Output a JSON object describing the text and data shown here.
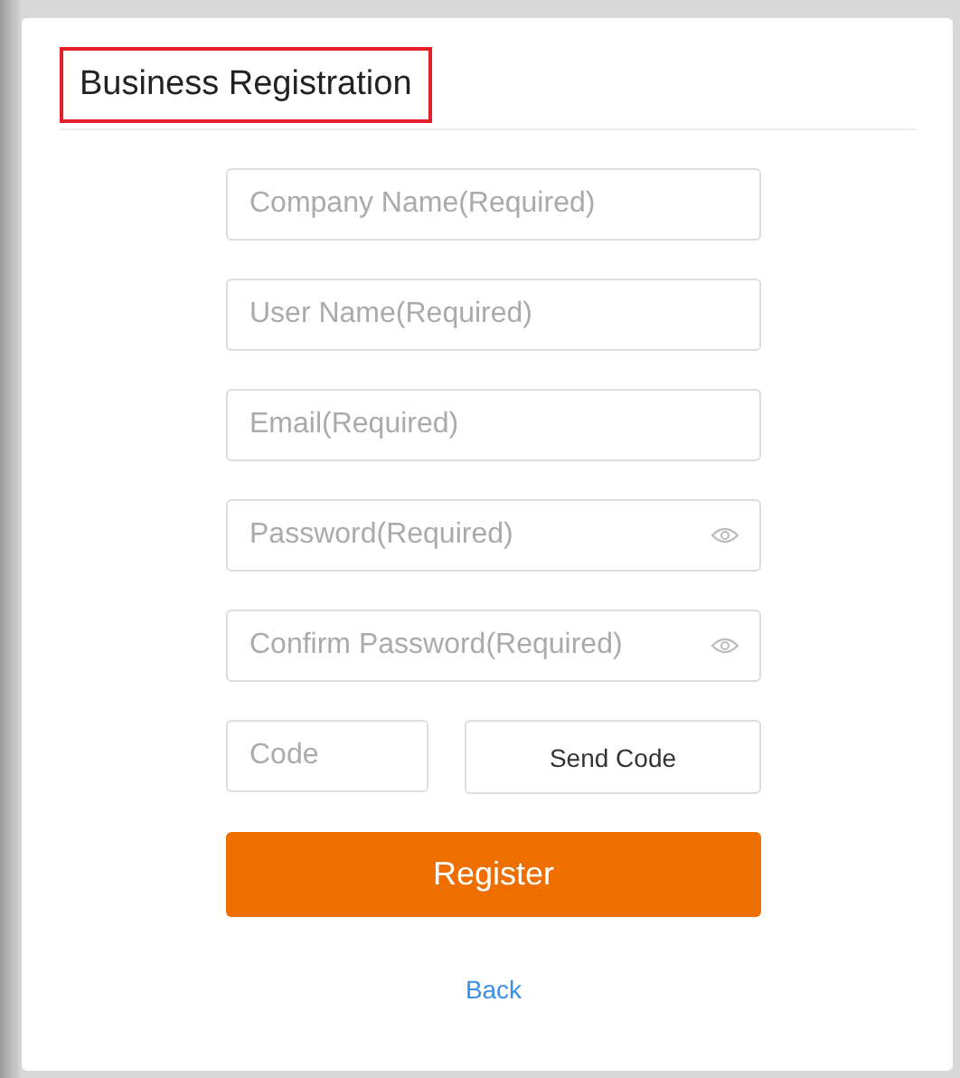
{
  "title": "Business Registration",
  "fields": [
    {
      "placeholder": "Company Name(Required)",
      "kind": "text"
    },
    {
      "placeholder": "User Name(Required)",
      "kind": "text"
    },
    {
      "placeholder": "Email(Required)",
      "kind": "text"
    },
    {
      "placeholder": "Password(Required)",
      "kind": "password"
    },
    {
      "placeholder": "Confirm Password(Required)",
      "kind": "password"
    }
  ],
  "code": {
    "placeholder": "Code",
    "button": "Send Code"
  },
  "register_button": "Register",
  "back_link": "Back"
}
